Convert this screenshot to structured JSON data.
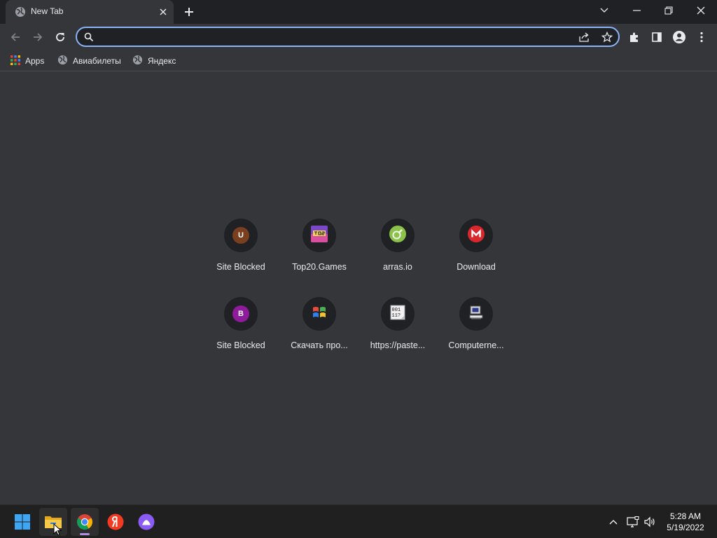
{
  "window": {
    "tab_title": "New Tab",
    "tab_close_icon": "close-icon",
    "new_tab_icon": "plus-icon",
    "controls": [
      "chevron-down-icon",
      "minimize-icon",
      "restore-icon",
      "close-icon"
    ]
  },
  "toolbar": {
    "back_icon": "arrow-left-icon",
    "forward_icon": "arrow-right-icon",
    "reload_icon": "reload-icon",
    "omnibox": {
      "value": "",
      "placeholder": ""
    },
    "omnibox_actions": [
      "share-icon",
      "star-icon"
    ],
    "right_icons": [
      "extensions-icon",
      "side-panel-icon",
      "profile-icon",
      "more-vertical-icon"
    ]
  },
  "bookmarks": {
    "items": [
      {
        "label": "Apps",
        "icon": "apps-grid-icon"
      },
      {
        "label": "Авиабилеты",
        "icon": "globe-icon"
      },
      {
        "label": "Яндекс",
        "icon": "globe-icon"
      }
    ]
  },
  "shortcuts": [
    {
      "label": "Site Blocked",
      "icon": "letter-u-icon",
      "letter": "U",
      "color": "#7a3f1f"
    },
    {
      "label": "Top20.Games",
      "icon": "top20-games-icon",
      "color": "#7a47c9"
    },
    {
      "label": "arras.io",
      "icon": "arras-icon",
      "color": "#8bc34a"
    },
    {
      "label": "Download",
      "icon": "mega-icon",
      "letter": "M",
      "color": "#d9272e"
    },
    {
      "label": "Site Blocked",
      "icon": "letter-b-icon",
      "letter": "B",
      "color": "#8e1b99"
    },
    {
      "label": "Скачать про...",
      "icon": "windows-flag-icon"
    },
    {
      "label": "https://paste...",
      "icon": "binary-doc-icon",
      "text": "001\n11?"
    },
    {
      "label": "Computerne...",
      "icon": "computer-icon"
    }
  ],
  "taskbar": {
    "apps": [
      "windows-start-icon",
      "file-explorer-icon",
      "chrome-icon",
      "yandex-browser-icon",
      "alice-icon"
    ],
    "active_app": "chrome-icon",
    "tray_icons": [
      "chevron-up-icon",
      "network-icon",
      "volume-icon"
    ],
    "time": "5:28 AM",
    "date": "5/19/2022"
  },
  "colors": {
    "tab_strip": "#202124",
    "page_background": "#35363a",
    "omnibox_border": "#8ab4f8",
    "taskbar": "#202020"
  }
}
